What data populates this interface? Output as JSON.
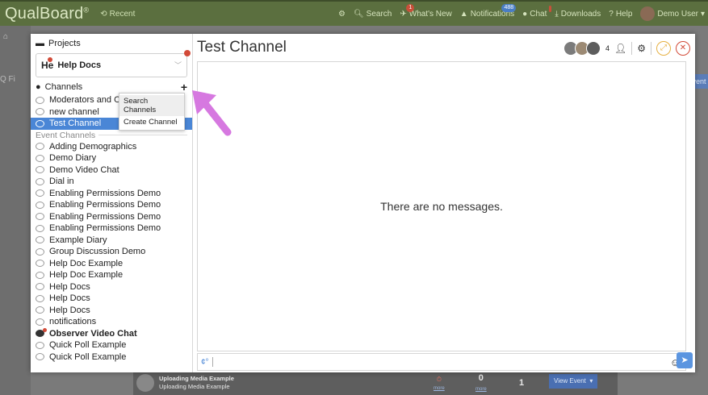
{
  "nav": {
    "brand": "QualBoard",
    "brand_mark": "®",
    "recent": "Recent",
    "search": "Search",
    "whats_new": "What's New",
    "whats_new_badge": "1",
    "notifications": "Notifications",
    "notifications_badge": "488",
    "chat": "Chat",
    "downloads": "Downloads",
    "help": "Help",
    "user": "Demo User"
  },
  "background": {
    "search_hint": "Q Fi",
    "right_button": "vent",
    "bottom_title": "Uploading Media Example",
    "bottom_subtitle": "Uploading Media Example",
    "bottom_count1": "0",
    "bottom_count2": "1",
    "bottom_more1": "more",
    "bottom_more2": "more",
    "view_event": "View Event"
  },
  "sidebar": {
    "projects_label": "Projects",
    "project_initials": "He",
    "project_name": "Help Docs",
    "channels_label": "Channels",
    "channels": [
      "Moderators and O",
      "new channel",
      "Test Channel"
    ],
    "event_channels_label": "Event Channels",
    "event_channels": [
      "Adding Demographics",
      "Demo Diary",
      "Demo Video Chat",
      "Dial in",
      "Enabling Permissions Demo",
      "Enabling Permissions Demo",
      "Enabling Permissions Demo",
      "Enabling Permissions Demo",
      "Example Diary",
      "Group Discussion Demo",
      "Help Doc Example",
      "Help Doc Example",
      "Help Docs",
      "Help Docs",
      "Help Docs",
      "notifications",
      "Observer Video Chat",
      "Quick Poll Example",
      "Quick Poll Example"
    ]
  },
  "popup": {
    "search_channels": "Search Channels",
    "create_channel": "Create Channel"
  },
  "main": {
    "title": "Test Channel",
    "member_count": "4",
    "empty_message": "There are no messages."
  },
  "colors": {
    "topbar": "#5b6f3f",
    "active": "#4a86d6",
    "alert": "#d24a38",
    "arrow": "#d678e0"
  }
}
